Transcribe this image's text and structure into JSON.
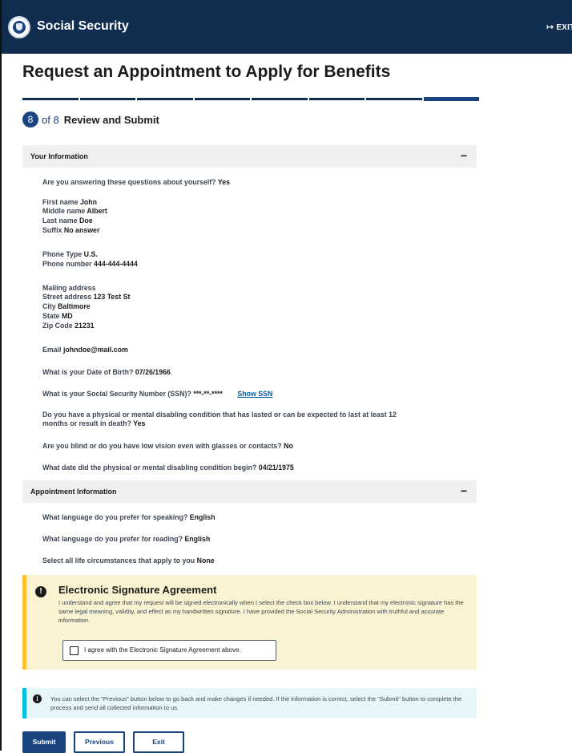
{
  "header": {
    "brand": "Social Security",
    "exit_label": "EXIT"
  },
  "page": {
    "title": "Request an Appointment to Apply for Benefits"
  },
  "progress": {
    "current_step": "8",
    "of_total": "of 8",
    "step_name": "Review and Submit",
    "total_steps": 8
  },
  "your_information": {
    "heading": "Your Information",
    "toggle": "−",
    "about_self": {
      "label": "Are you answering these questions about yourself?",
      "value": "Yes"
    },
    "first_name": {
      "label": "First name",
      "value": "John"
    },
    "middle_name": {
      "label": "Middle name",
      "value": "Albert"
    },
    "last_name": {
      "label": "Last name",
      "value": "Doe"
    },
    "suffix": {
      "label": "Suffix",
      "value": "No answer"
    },
    "phone_type": {
      "label": "Phone Type",
      "value": "U.S."
    },
    "phone_number": {
      "label": "Phone number",
      "value": "444-444-4444"
    },
    "mailing_address": {
      "label": "Mailing address"
    },
    "street": {
      "label": "Street address",
      "value": "123 Test St"
    },
    "city": {
      "label": "City",
      "value": "Baltimore"
    },
    "state": {
      "label": "State",
      "value": "MD"
    },
    "zip": {
      "label": "Zip Code",
      "value": "21231"
    },
    "email": {
      "label": "Email",
      "value": "johndoe@mail.com"
    },
    "dob": {
      "label": "What is your Date of Birth?",
      "value": "07/26/1966"
    },
    "ssn": {
      "label": "What is your Social Security Number (SSN)?",
      "value": "***-**-****",
      "link": "Show SSN"
    },
    "disabling_condition": {
      "label_line1": "Do you have a physical or mental disabling condition that has lasted or can be expected to last at least 12",
      "label_line2": "months or result in death?",
      "value": "Yes"
    },
    "blind": {
      "label": "Are you blind or do you have low vision even with glasses or contacts?",
      "value": "No"
    },
    "condition_begin": {
      "label": "What date did the physical or mental disabling condition begin?",
      "value": "04/21/1975"
    }
  },
  "appointment_information": {
    "heading": "Appointment Information",
    "toggle": "−",
    "speaking": {
      "label": "What language do you prefer for speaking?",
      "value": "English"
    },
    "reading": {
      "label": "What language do you prefer for reading?",
      "value": "English"
    },
    "circumstances": {
      "label": "Select all life circumstances that apply to you",
      "value": "None"
    }
  },
  "esignature": {
    "icon": "alert-icon",
    "heading": "Electronic Signature Agreement",
    "body": "I understand and agree that my request will be signed electronically when I select the check box below. I understand that my electronic signature has the same legal meaning, validity, and effect as my handwritten signature. I have provided the Social Security Administration with truthful and accurate information.",
    "checkbox_label": "I agree with the Electronic Signature Agreement above.",
    "checked": false
  },
  "info_notice": {
    "icon": "info-icon",
    "text": "You can select the \"Previous\" button below to go back and make changes if needed. If the information is correct, select the \"Submit\" button to complete the process and send all collected information to us."
  },
  "actions": {
    "submit": "Submit",
    "previous": "Previous",
    "exit": "Exit"
  },
  "colors": {
    "header_bg": "#112e51",
    "primary": "#1a4480",
    "warning_bg": "#faf3d1",
    "warning_border": "#ffbe2e",
    "info_bg": "#e7f6f8",
    "info_border": "#00bde3",
    "link": "#005ea2"
  }
}
